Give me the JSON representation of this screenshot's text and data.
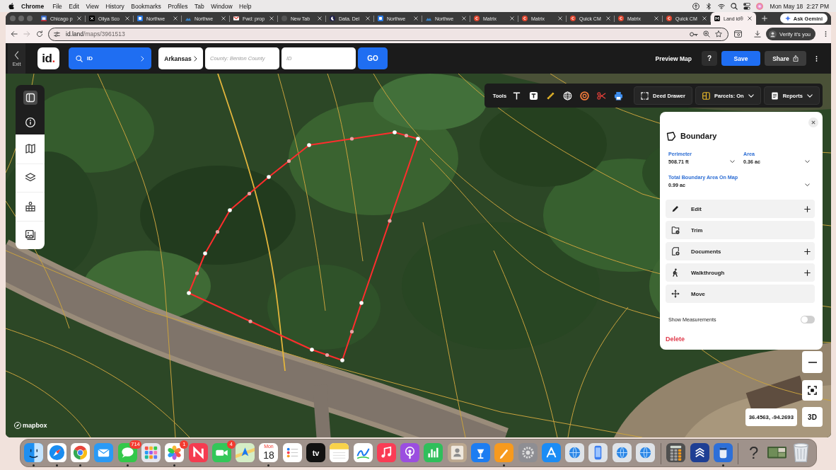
{
  "menubar": {
    "app": "Chrome",
    "menus": [
      "File",
      "Edit",
      "View",
      "History",
      "Bookmarks",
      "Profiles",
      "Tab",
      "Window",
      "Help"
    ],
    "date": "Mon May 18",
    "time": "2:27 PM"
  },
  "browser": {
    "tabs": [
      {
        "title": "Chicago p",
        "selected": false
      },
      {
        "title": "Oliya Sco",
        "selected": false
      },
      {
        "title": "Northwe",
        "selected": false
      },
      {
        "title": "Northwe",
        "selected": false
      },
      {
        "title": "Fwd: prop",
        "selected": false
      },
      {
        "title": "New Tab",
        "selected": false
      },
      {
        "title": "Data. Del",
        "selected": false
      },
      {
        "title": "Northwe",
        "selected": false
      },
      {
        "title": "Northwe",
        "selected": false
      },
      {
        "title": "Matrix",
        "selected": false
      },
      {
        "title": "Matrix",
        "selected": false
      },
      {
        "title": "Quick CM",
        "selected": false
      },
      {
        "title": "Matrix",
        "selected": false
      },
      {
        "title": "Quick CM",
        "selected": false
      },
      {
        "title": "Land id®",
        "selected": true
      }
    ],
    "assistant": "Ask Gemini",
    "forward_disabled": true,
    "url": {
      "host": "id.land",
      "path": "/maps/3961513"
    },
    "profile": "Verify it's you"
  },
  "header": {
    "exit": "Exit",
    "logo": "id.",
    "search_mode": "ID",
    "state": "Arkansas",
    "county": {
      "placeholder": "County: Benton County"
    },
    "parcel_id": {
      "placeholder": "ID"
    },
    "go": "GO",
    "preview": "Preview Map",
    "help": "?",
    "save": "Save",
    "share": "Share"
  },
  "map": {
    "sidebar": {
      "groups": [
        {
          "kind": "dark",
          "items": [
            {
              "selected": true
            },
            {
              "selected": false
            }
          ]
        },
        {
          "kind": "light",
          "items": [
            {
              "selected": false
            },
            {
              "selected": false
            },
            {
              "selected": false
            },
            {
              "selected": false
            }
          ]
        }
      ]
    },
    "toolbar": {
      "label": "Tools",
      "deed_drawer": "Deed Drawer",
      "parcels": "Parcels: On",
      "reports": "Reports"
    },
    "panel": {
      "title": "Boundary",
      "measures": [
        {
          "label": "Perimeter",
          "value": "508.71 ft"
        },
        {
          "label": "Area",
          "value": "0.36 ac"
        },
        {
          "label": "Total Boundary Area On Map",
          "value": "0.99 ac"
        }
      ],
      "actions": [
        {
          "label": "Edit",
          "expandable": true
        },
        {
          "label": "Trim",
          "expandable": false
        },
        {
          "label": "Documents",
          "expandable": true
        },
        {
          "label": "Walkthrough",
          "expandable": true
        },
        {
          "label": "Move",
          "expandable": false
        }
      ],
      "toggle": {
        "label": "Show Measurements",
        "on": false
      },
      "delete": "Delete"
    },
    "coordinates": "36.4563, -94.2693",
    "view_3d": "3D",
    "attribution": "mapbox"
  },
  "dock": {
    "sections": [
      {
        "items": [
          {
            "kind": "app",
            "running": true
          },
          {
            "kind": "app",
            "running": true
          },
          {
            "kind": "app",
            "running": true
          },
          {
            "kind": "app",
            "running": false
          },
          {
            "kind": "app",
            "running": true,
            "badge": "714"
          },
          {
            "kind": "app",
            "running": false
          },
          {
            "kind": "app",
            "running": true,
            "badge": "1"
          },
          {
            "kind": "app",
            "running": false
          },
          {
            "kind": "app",
            "running": false,
            "badge": "4"
          },
          {
            "kind": "app",
            "running": false
          },
          {
            "kind": "calendar",
            "running": true,
            "weekday": "Mon",
            "day": "18"
          },
          {
            "kind": "app",
            "running": false
          },
          {
            "kind": "labeled",
            "running": false,
            "label": "tv"
          },
          {
            "kind": "app",
            "running": false
          },
          {
            "kind": "app",
            "running": false
          },
          {
            "kind": "app",
            "running": false
          },
          {
            "kind": "app",
            "running": false
          },
          {
            "kind": "app",
            "running": false
          },
          {
            "kind": "app",
            "running": false
          },
          {
            "kind": "app",
            "running": false
          },
          {
            "kind": "app",
            "running": true
          },
          {
            "kind": "app",
            "running": false
          },
          {
            "kind": "app",
            "running": false
          },
          {
            "kind": "app",
            "running": false
          },
          {
            "kind": "app",
            "running": false
          },
          {
            "kind": "app",
            "running": false
          },
          {
            "kind": "app",
            "running": false
          }
        ]
      },
      {
        "items": [
          {
            "kind": "app",
            "running": false
          },
          {
            "kind": "app",
            "running": false
          },
          {
            "kind": "app",
            "running": true
          }
        ]
      },
      {
        "items": [
          {
            "kind": "glyph",
            "running": false,
            "glyph": "?"
          },
          {
            "kind": "picture",
            "running": false
          },
          {
            "kind": "trash",
            "running": false
          }
        ]
      }
    ]
  }
}
